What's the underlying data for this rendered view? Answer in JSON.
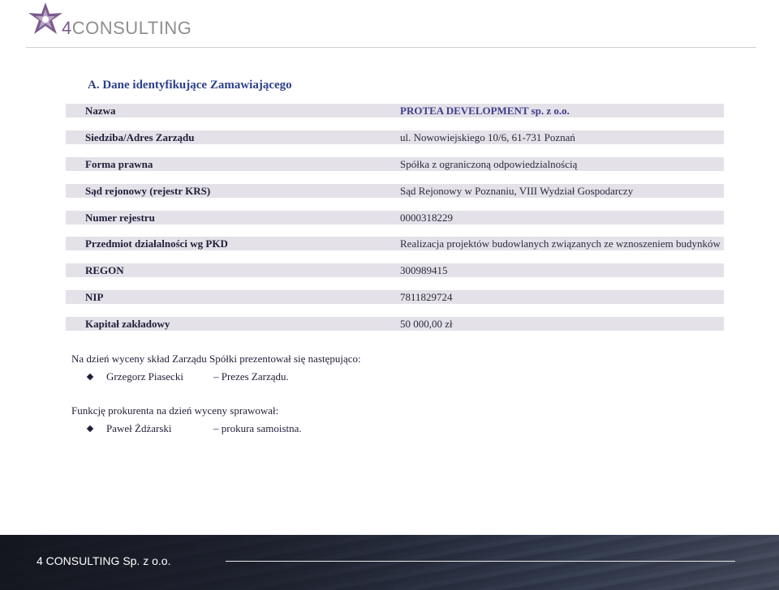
{
  "header": {
    "logo_number": "4",
    "logo_word": "CONSULTING"
  },
  "section": {
    "heading": "A.  Dane identyfikujące Zamawiającego"
  },
  "info_rows": [
    {
      "label": "Nazwa",
      "value": "PROTEA DEVELOPMENT sp. z o.o."
    },
    {
      "label": "Siedziba/Adres Zarządu",
      "value": "ul. Nowowiejskiego 10/6, 61-731 Poznań"
    },
    {
      "label": "Forma prawna",
      "value": "Spółka z ograniczoną odpowiedzialnością"
    },
    {
      "label": "Sąd rejonowy (rejestr KRS)",
      "value": "Sąd Rejonowy w Poznaniu, VIII Wydział Gospodarczy"
    },
    {
      "label": "Numer rejestru",
      "value": "0000318229"
    },
    {
      "label": "Przedmiot działalności wg PKD",
      "value": "Realizacja projektów budowlanych związanych ze wznoszeniem budynków"
    },
    {
      "label": "REGON",
      "value": "300989415"
    },
    {
      "label": "NIP",
      "value": "7811829724"
    },
    {
      "label": "Kapitał zakładowy",
      "value": "50 000,00 zł"
    }
  ],
  "board": {
    "intro": "Na dzień wyceny skład Zarządu Spółki  prezentował się następująco:",
    "members": [
      {
        "name": "Grzegorz Piasecki",
        "role": "– Prezes Zarządu."
      }
    ]
  },
  "proxy": {
    "intro": "Funkcję prokurenta na dzień wyceny sprawował:",
    "members": [
      {
        "name": "Paweł Żdżarski",
        "role": "– prokura samoistna."
      }
    ]
  },
  "footer": {
    "company": "4 CONSULTING Sp. z o.o."
  }
}
